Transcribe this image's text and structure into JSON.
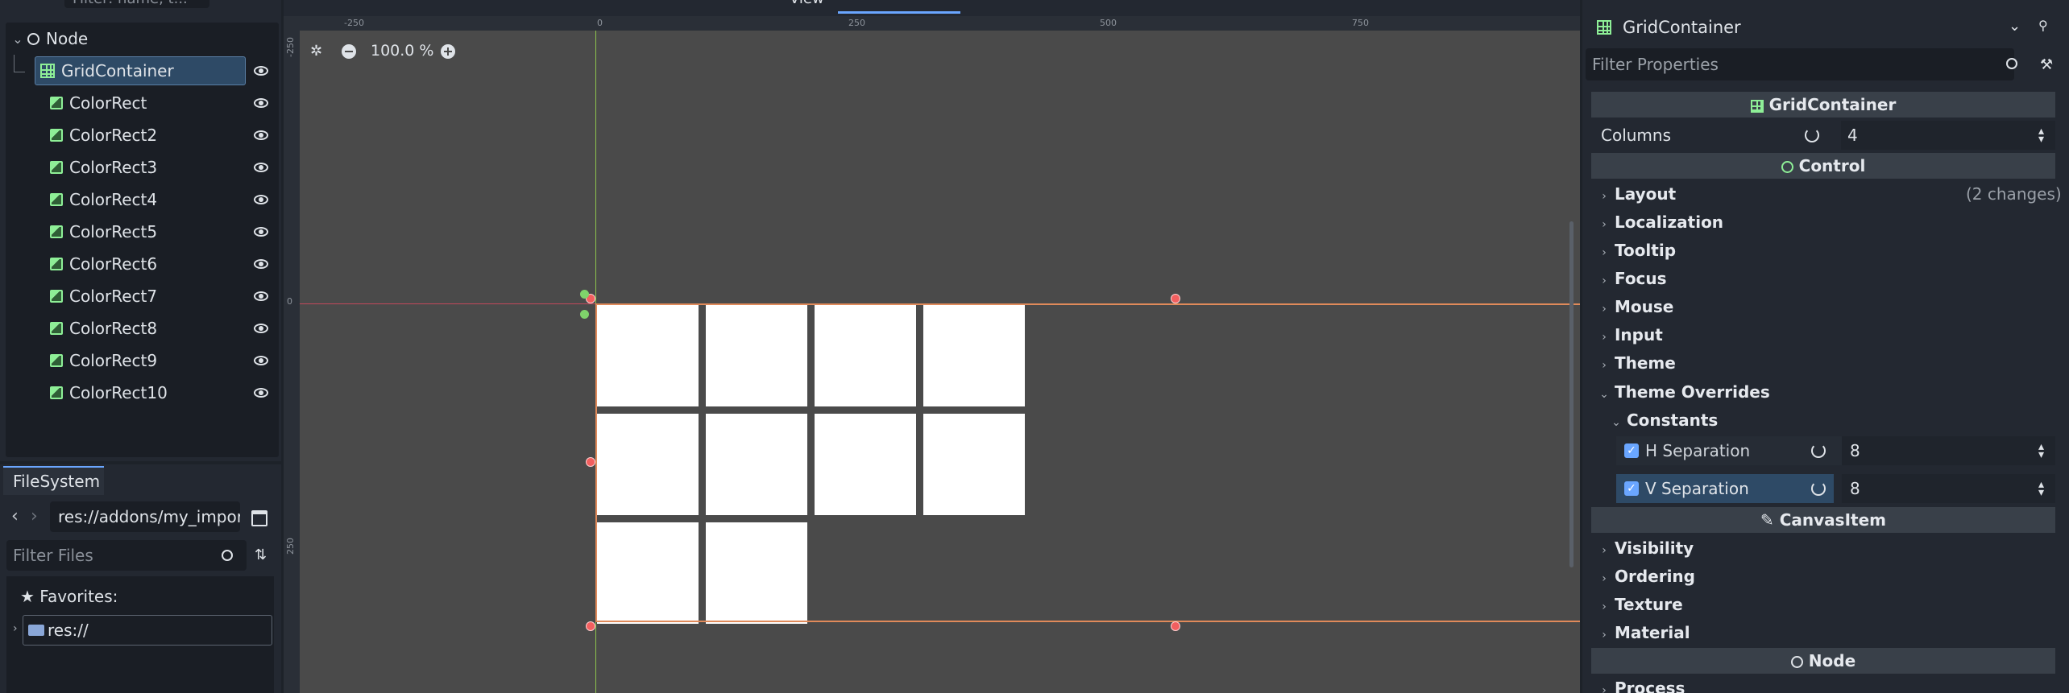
{
  "scene": {
    "filter_placeholder": "Filter: name, t...",
    "root": "Node",
    "selected": "GridContainer",
    "children": [
      "ColorRect",
      "ColorRect2",
      "ColorRect3",
      "ColorRect4",
      "ColorRect5",
      "ColorRect6",
      "ColorRect7",
      "ColorRect8",
      "ColorRect9",
      "ColorRect10"
    ]
  },
  "filesystem": {
    "tab": "FileSystem",
    "path": "res://addons/my_impor",
    "filter_placeholder": "Filter Files",
    "favorites": "Favorites:",
    "root": "res://"
  },
  "viewport": {
    "view_menu": "View",
    "zoom": "100.0 %",
    "ruler_x": [
      "-250",
      "0",
      "250",
      "500",
      "750"
    ],
    "ruler_y": [
      "-250",
      "0",
      "250"
    ],
    "accent": "#6aa6ff",
    "selection_color": "#e08a5a",
    "grid_cells": 10
  },
  "inspector": {
    "node": "GridContainer",
    "filter_placeholder": "Filter Properties",
    "sections": {
      "grid": "GridContainer",
      "control": "Control",
      "canvas": "CanvasItem",
      "node": "Node"
    },
    "columns_label": "Columns",
    "columns_value": "4",
    "layout": "Layout",
    "layout_changes": "(2 changes)",
    "groups": [
      "Localization",
      "Tooltip",
      "Focus",
      "Mouse",
      "Input",
      "Theme"
    ],
    "theme_overrides": "Theme Overrides",
    "constants": "Constants",
    "h_sep_label": "H Separation",
    "h_sep_value": "8",
    "v_sep_label": "V Separation",
    "v_sep_value": "8",
    "canvas_groups": [
      "Visibility",
      "Ordering",
      "Texture",
      "Material"
    ],
    "process": "Process"
  }
}
